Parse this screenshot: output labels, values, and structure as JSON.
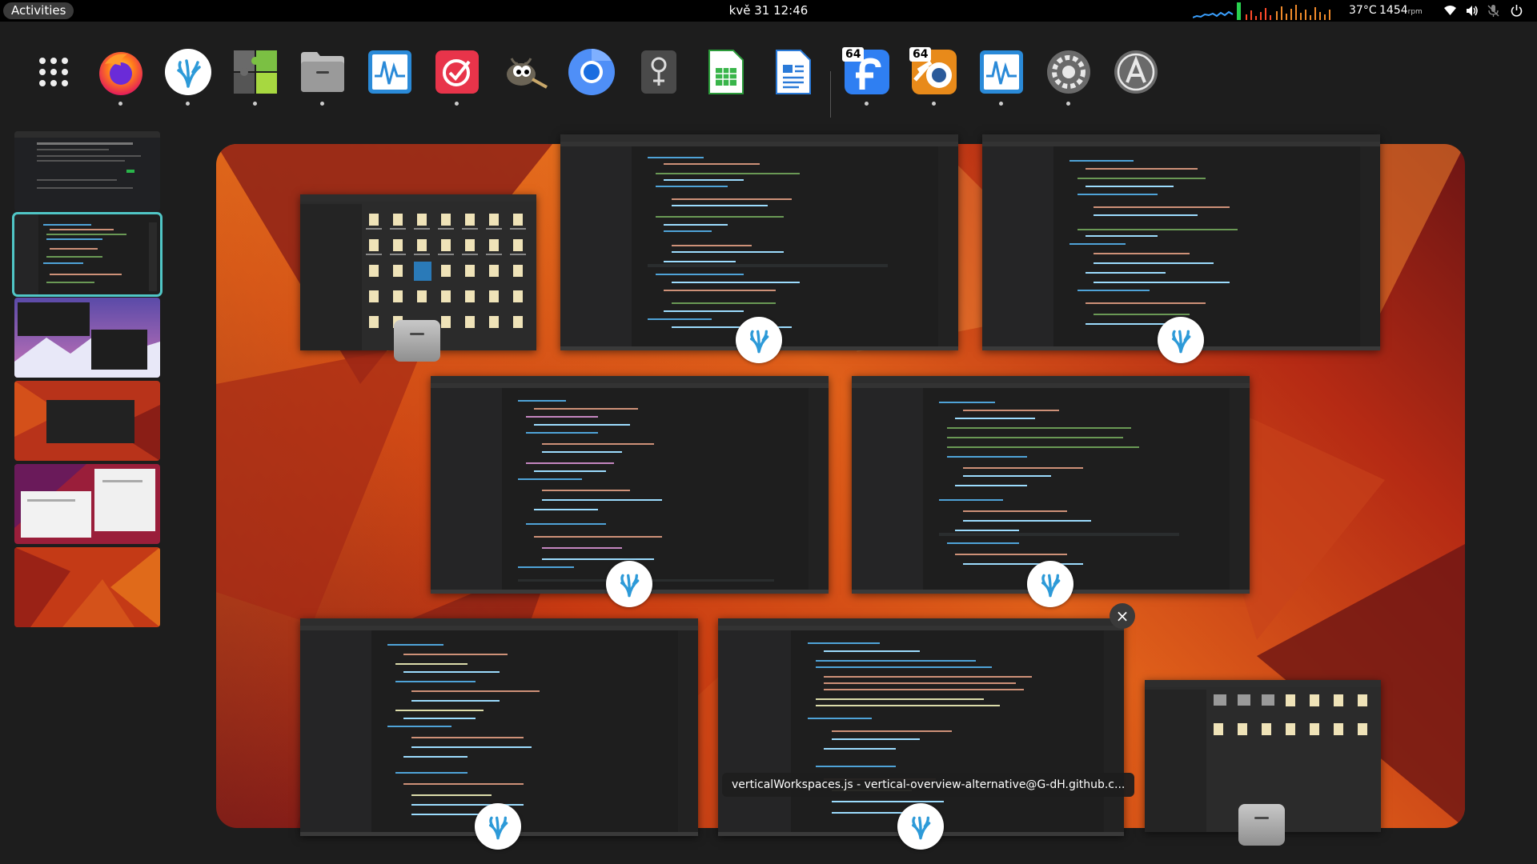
{
  "topbar": {
    "activities_label": "Activities",
    "clock": "kvě 31  12:46",
    "temperature": "37°C",
    "fan_rpm_value": "1454",
    "fan_rpm_unit": "rpm",
    "icons": [
      "system-monitor-graph",
      "wifi-icon",
      "volume-icon",
      "microphone-off-icon",
      "power-icon"
    ]
  },
  "dash": {
    "apps": [
      {
        "name": "app-grid",
        "icon": "app-grid-icon",
        "running": false
      },
      {
        "name": "Firefox",
        "icon": "firefox-icon",
        "running": true
      },
      {
        "name": "VSCodium",
        "icon": "vscodium-icon",
        "running": true
      },
      {
        "name": "Extensions",
        "icon": "extensions-icon",
        "running": true
      },
      {
        "name": "Files",
        "icon": "files-icon",
        "running": true
      },
      {
        "name": "System Monitor",
        "icon": "system-monitor-icon",
        "running": false
      },
      {
        "name": "Tasks",
        "icon": "tasks-icon",
        "running": true
      },
      {
        "name": "GIMP",
        "icon": "gimp-icon",
        "running": false
      },
      {
        "name": "Chromium",
        "icon": "chromium-icon",
        "running": false
      },
      {
        "name": "Key Manager",
        "icon": "keyring-icon",
        "running": false
      },
      {
        "name": "Spreadsheet",
        "icon": "spreadsheet-icon",
        "running": false
      },
      {
        "name": "Writer",
        "icon": "writer-icon",
        "running": false
      },
      {
        "name": "Fedora Media Writer",
        "icon": "fedora-icon",
        "badge": "64",
        "running": true
      },
      {
        "name": "Blender",
        "icon": "blender-icon",
        "badge": "64",
        "running": true
      },
      {
        "name": "System Monitor 2",
        "icon": "system-monitor-icon",
        "running": true
      },
      {
        "name": "Settings",
        "icon": "settings-icon",
        "running": true
      },
      {
        "name": "Software Updater",
        "icon": "software-updater-icon",
        "running": false
      }
    ]
  },
  "workspaces": {
    "count": 6,
    "active_index": 1
  },
  "tooltip": {
    "text": "verticalWorkspaces.js - vertical-overview-alternative@G-dH.github.c..."
  },
  "colors": {
    "accent": "#50c6c6",
    "wallpaper_primary": "#c83a12",
    "editor_bg": "#1e1e1e"
  }
}
